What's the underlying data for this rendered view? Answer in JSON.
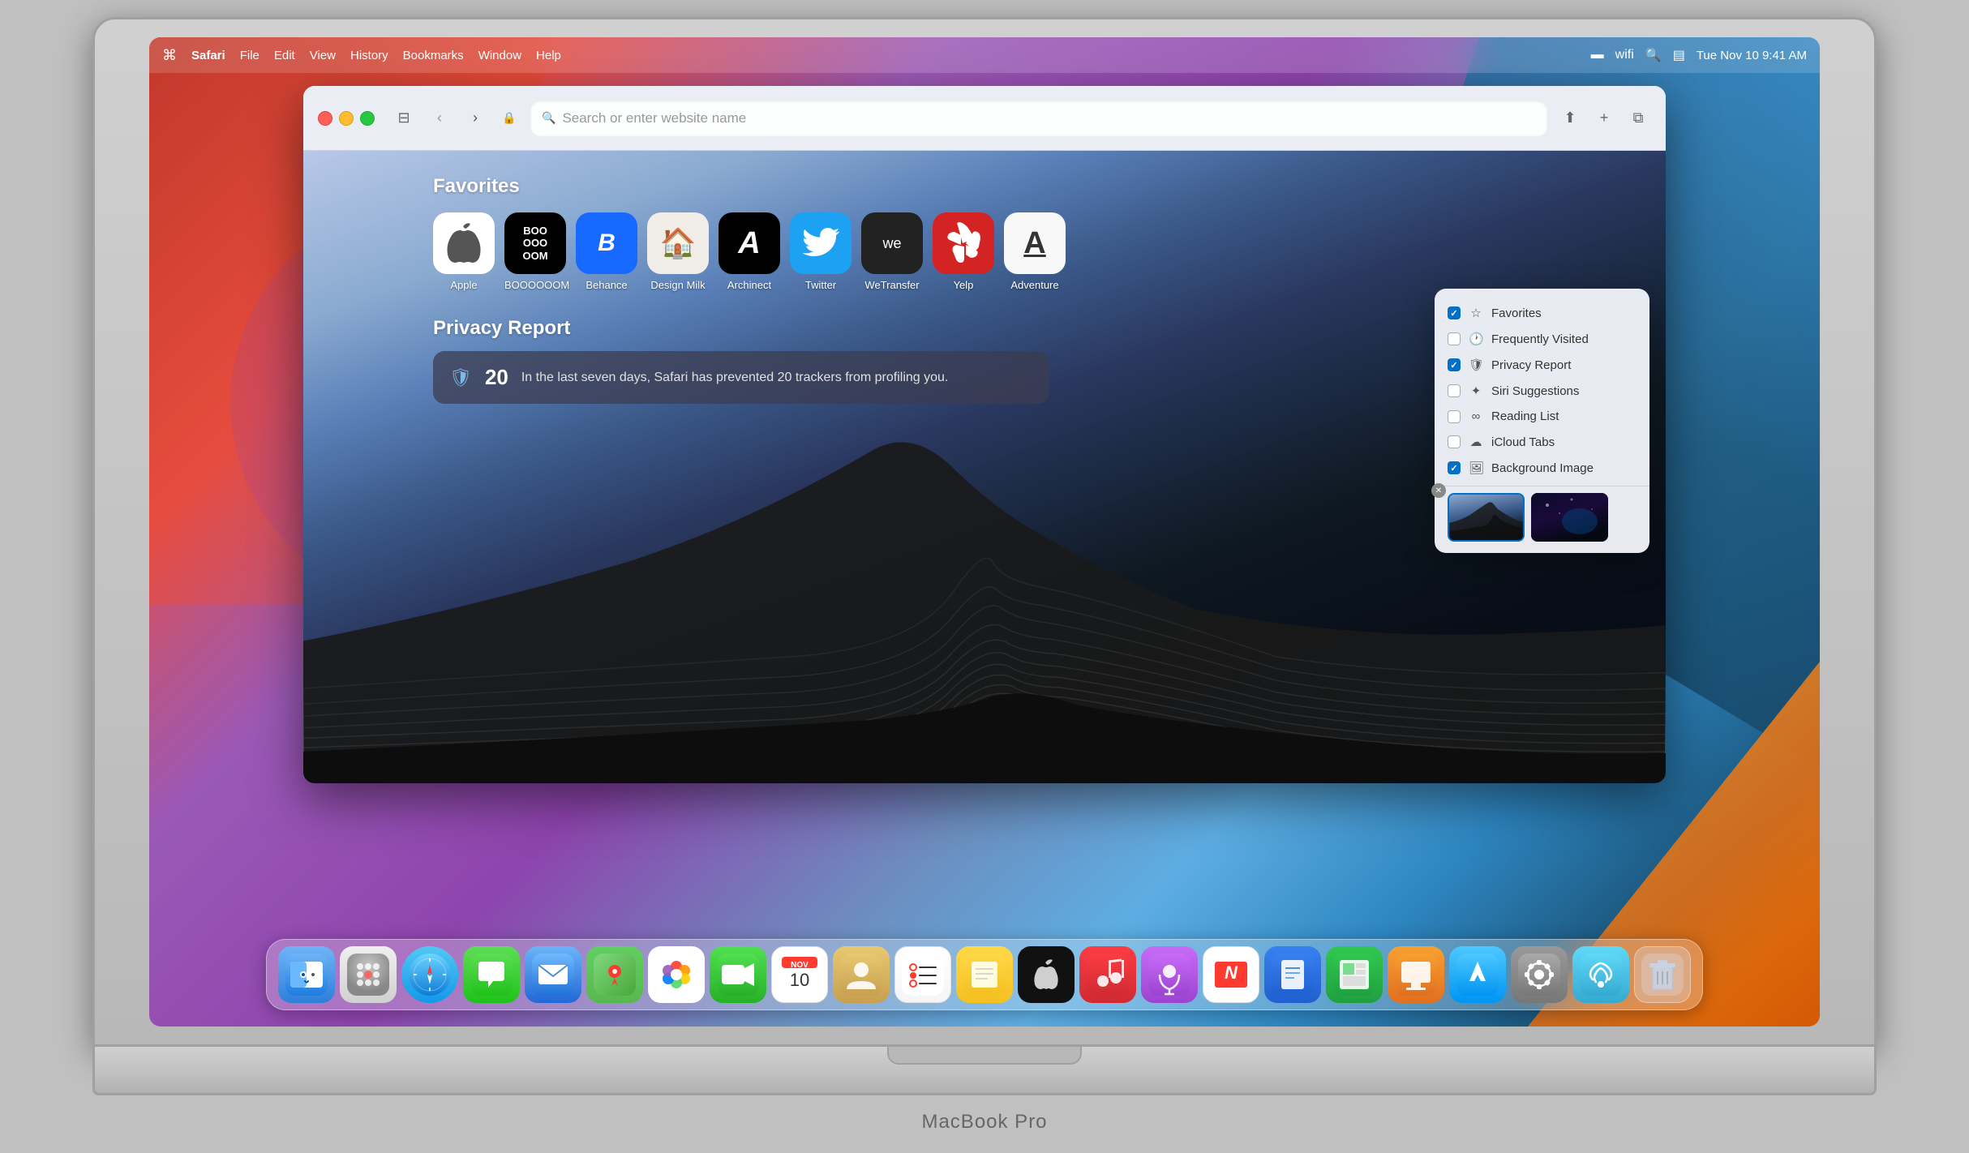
{
  "macbook": {
    "label": "MacBook Pro"
  },
  "menubar": {
    "apple": "⌘",
    "items": [
      "Safari",
      "File",
      "Edit",
      "View",
      "History",
      "Bookmarks",
      "Window",
      "Help"
    ],
    "right": {
      "datetime": "Tue Nov 10  9:41 AM"
    }
  },
  "safari": {
    "addressbar": {
      "placeholder": "Search or enter website name"
    },
    "favorites": {
      "title": "Favorites",
      "items": [
        {
          "name": "Apple",
          "icon": "🍎",
          "style": "fav-apple"
        },
        {
          "name": "BOOOOOOM",
          "icon": "BOO\nOOO\nOOM",
          "style": "fav-boooom"
        },
        {
          "name": "Behance",
          "icon": "Bē",
          "style": "fav-behance"
        },
        {
          "name": "Design Milk",
          "icon": "🏠",
          "style": "fav-designmilk"
        },
        {
          "name": "Archinect",
          "icon": "A",
          "style": "fav-archinect"
        },
        {
          "name": "Twitter",
          "icon": "🐦",
          "style": "fav-twitter"
        },
        {
          "name": "WeTransfer",
          "icon": "we",
          "style": "fav-wetransfer"
        },
        {
          "name": "Yelp",
          "icon": "☆",
          "style": "fav-yelp"
        },
        {
          "name": "Adventure",
          "icon": "A̲",
          "style": "fav-adventure"
        }
      ]
    },
    "privacySection": {
      "title": "Privacy Report",
      "trackers": "20",
      "message": "In the last seven days, Safari has prevented 20 trackers from profiling you."
    },
    "customizePanel": {
      "items": [
        {
          "label": "Favorites",
          "checked": true,
          "icon": "☆"
        },
        {
          "label": "Frequently Visited",
          "checked": false,
          "icon": "🕐"
        },
        {
          "label": "Privacy Report",
          "checked": true,
          "icon": "🛡"
        },
        {
          "label": "Siri Suggestions",
          "checked": false,
          "icon": "✦"
        },
        {
          "label": "Reading List",
          "checked": false,
          "icon": "∞"
        },
        {
          "label": "iCloud Tabs",
          "checked": false,
          "icon": "☁"
        },
        {
          "label": "Background Image",
          "checked": true,
          "icon": "🖼"
        }
      ],
      "bgImages": [
        {
          "name": "Big Sur Mountains",
          "selected": true,
          "style": "thumb-mountain"
        },
        {
          "name": "Space",
          "selected": false,
          "style": "thumb-space"
        }
      ]
    }
  },
  "dock": {
    "items": [
      {
        "name": "Finder",
        "emoji": "😊",
        "style": "dock-finder"
      },
      {
        "name": "Launchpad",
        "emoji": "⬛",
        "style": "dock-launchpad"
      },
      {
        "name": "Safari",
        "emoji": "🧭",
        "style": "dock-safari"
      },
      {
        "name": "Messages",
        "emoji": "💬",
        "style": "dock-messages"
      },
      {
        "name": "Mail",
        "emoji": "✉",
        "style": "dock-mail"
      },
      {
        "name": "Maps",
        "emoji": "🗺",
        "style": "dock-maps"
      },
      {
        "name": "Photos",
        "emoji": "🌸",
        "style": "dock-photos"
      },
      {
        "name": "FaceTime",
        "emoji": "📷",
        "style": "dock-facetime"
      },
      {
        "name": "Calendar",
        "emoji": "📅",
        "style": "dock-calendar"
      },
      {
        "name": "Contacts",
        "emoji": "👤",
        "style": "dock-contacts"
      },
      {
        "name": "Reminders",
        "emoji": "☑",
        "style": "dock-reminders"
      },
      {
        "name": "Notes",
        "emoji": "📝",
        "style": "dock-notes"
      },
      {
        "name": "Apple TV",
        "emoji": "📺",
        "style": "dock-appletv"
      },
      {
        "name": "Music",
        "emoji": "🎵",
        "style": "dock-music"
      },
      {
        "name": "Podcasts",
        "emoji": "🎙",
        "style": "dock-podcasts"
      },
      {
        "name": "News",
        "emoji": "📰",
        "style": "dock-news"
      },
      {
        "name": "Pages",
        "emoji": "📄",
        "style": "dock-pages"
      },
      {
        "name": "Numbers",
        "emoji": "📊",
        "style": "dock-numbers"
      },
      {
        "name": "Keynote",
        "emoji": "🎞",
        "style": "dock-keynote"
      },
      {
        "name": "App Store",
        "emoji": "🅐",
        "style": "dock-appstore"
      },
      {
        "name": "System Preferences",
        "emoji": "⚙",
        "style": "dock-systemprefs"
      },
      {
        "name": "AirDrop",
        "emoji": "📡",
        "style": "dock-airdrop"
      },
      {
        "name": "Trash",
        "emoji": "🗑",
        "style": "dock-trash"
      }
    ]
  }
}
